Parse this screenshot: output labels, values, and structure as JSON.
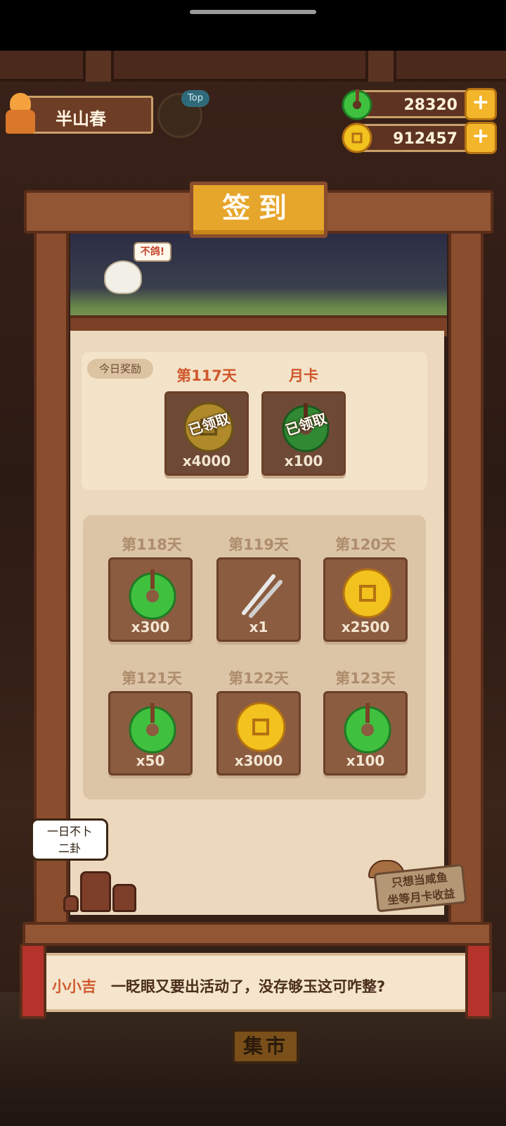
{
  "player": {
    "name": "半山春",
    "top_badge": "Top"
  },
  "currencies": [
    {
      "name": "jade",
      "value": "28320",
      "plus": "+"
    },
    {
      "name": "coin",
      "value": "912457",
      "plus": "+"
    }
  ],
  "panel": {
    "title": "签到",
    "bird_tag": "不鸽!",
    "today_label": "今日奖励",
    "today_rewards": [
      {
        "day": "第117天",
        "qty": "x4000",
        "icon": "coin-icon",
        "status": "已领取"
      },
      {
        "day": "月卡",
        "qty": "x100",
        "icon": "jade-icon",
        "status": "已领取"
      }
    ],
    "upcoming_rewards": [
      {
        "day": "第118天",
        "qty": "x300",
        "icon": "jade-icon"
      },
      {
        "day": "第119天",
        "qty": "x1",
        "icon": "chopsticks-icon"
      },
      {
        "day": "第120天",
        "qty": "x2500",
        "icon": "coin-icon"
      },
      {
        "day": "第121天",
        "qty": "x50",
        "icon": "jade-icon"
      },
      {
        "day": "第122天",
        "qty": "x3000",
        "icon": "coin-icon"
      },
      {
        "day": "第123天",
        "qty": "x100",
        "icon": "jade-icon"
      }
    ],
    "speech_bubble": {
      "line1": "一日不卜",
      "line2": "二卦"
    },
    "sign": {
      "line1": "只想当咸鱼",
      "line2": "坐等月卡收益"
    }
  },
  "dialog": {
    "speaker": "小小吉",
    "text": "一眨眼又要出活动了，没存够玉这可咋整?"
  },
  "scene": {
    "market_sign": "集市"
  },
  "colors": {
    "jade": "#3fc13f",
    "coin": "#f2c21e",
    "title_plaque": "#e6a52b",
    "wood": "#935634",
    "today_day_text": "#d0582d"
  }
}
